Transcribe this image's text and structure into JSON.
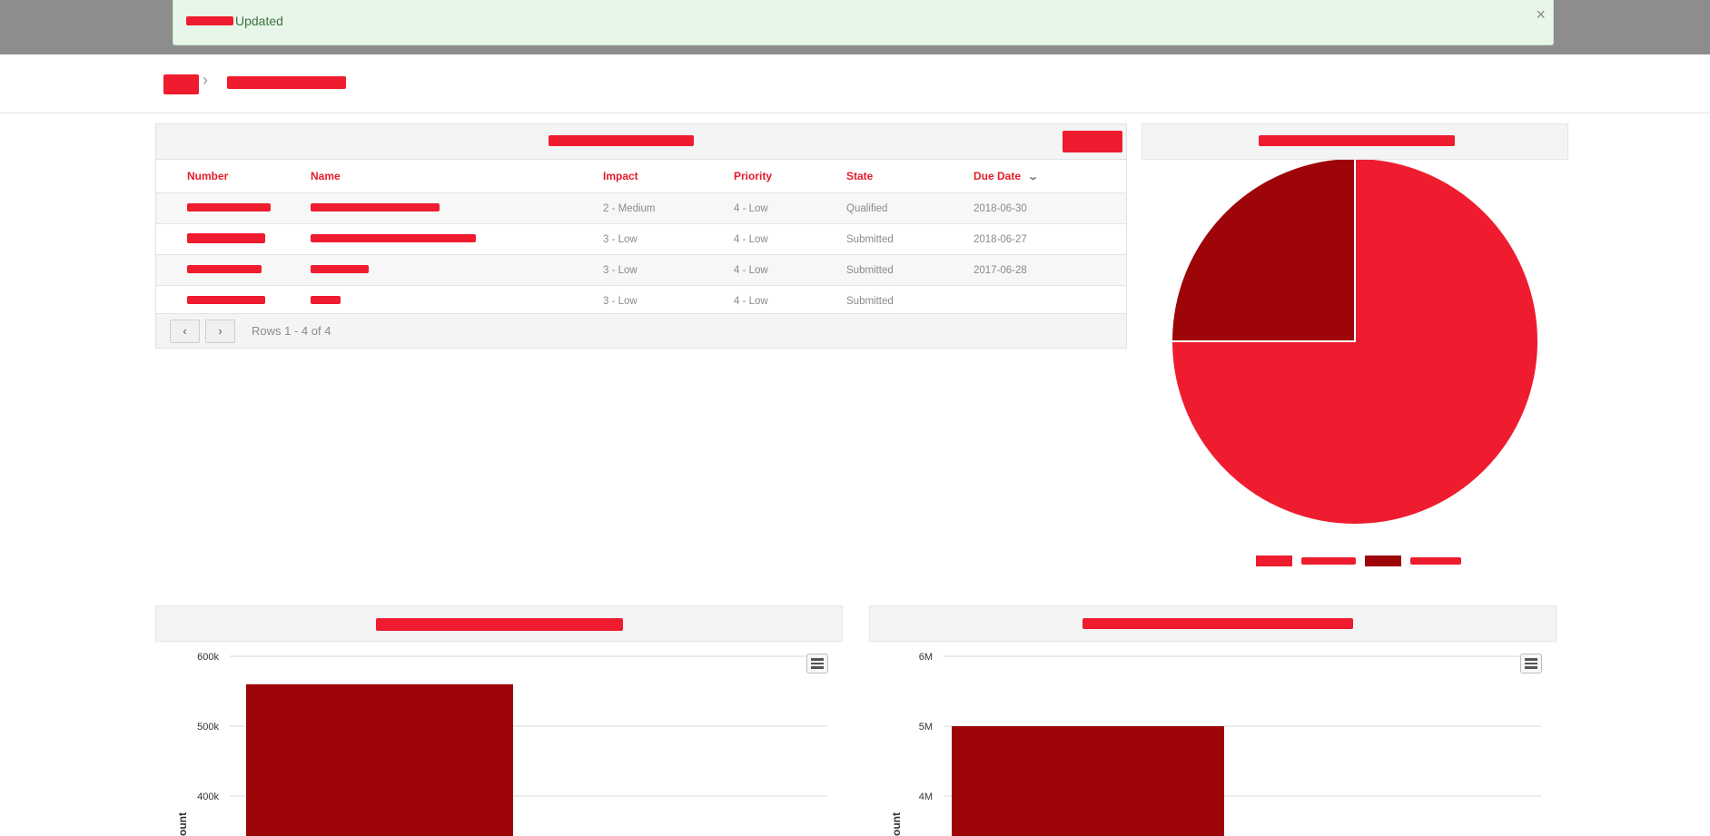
{
  "alert": {
    "text": "Updated",
    "close": "×"
  },
  "breadcrumb": {
    "separator": "›"
  },
  "list": {
    "columns": [
      "Number",
      "Name",
      "Impact",
      "Priority",
      "State",
      "Due Date"
    ],
    "rows": [
      {
        "impact": "2 - Medium",
        "priority": "4 - Low",
        "state": "Qualified",
        "due": "2018-06-30"
      },
      {
        "impact": "3 - Low",
        "priority": "4 - Low",
        "state": "Submitted",
        "due": "2018-06-27"
      },
      {
        "impact": "3 - Low",
        "priority": "4 - Low",
        "state": "Submitted",
        "due": "2017-06-28"
      },
      {
        "impact": "3 - Low",
        "priority": "4 - Low",
        "state": "Submitted",
        "due": ""
      }
    ],
    "pagination": {
      "rows_text": "Rows 1 - 4 of 4",
      "prev_icon": "chevron-left-icon",
      "next_icon": "chevron-right-icon"
    },
    "sort_icon": "chevron-down-icon"
  },
  "colors": {
    "accent_red": "#ee1c2e",
    "dark_red": "#9e0508",
    "alert_green": "#3c763d"
  },
  "chart_data": [
    {
      "type": "pie",
      "values": [
        75,
        25
      ],
      "colors": [
        "#ee1c2e",
        "#9e0508"
      ]
    },
    {
      "type": "bar",
      "yticks": [
        "600k",
        "500k",
        "400k"
      ],
      "ylabel": "ount",
      "values": [
        560000
      ],
      "ylim": [
        400000,
        600000
      ],
      "colors": [
        "#9e0508"
      ]
    },
    {
      "type": "bar",
      "yticks": [
        "6M",
        "5M",
        "4M"
      ],
      "ylabel": "ount",
      "values": [
        5000000
      ],
      "ylim": [
        4000000,
        6000000
      ],
      "colors": [
        "#9e0508"
      ]
    }
  ]
}
